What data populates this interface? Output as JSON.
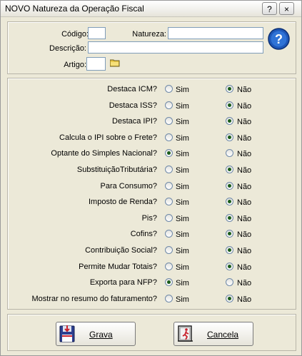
{
  "window": {
    "title": "NOVO Natureza da Operação Fiscal",
    "help_label": "?",
    "close_label": "×"
  },
  "form": {
    "codigo_label": "Código:",
    "natureza_label": "Natureza:",
    "descricao_label": "Descrição:",
    "artigo_label": "Artigo:",
    "codigo_value": "",
    "natureza_value": "",
    "descricao_value": "",
    "artigo_value": ""
  },
  "options": {
    "sim_label": "Sim",
    "nao_label": "Não",
    "questions": [
      {
        "label": "Destaca ICM?",
        "selected": "nao"
      },
      {
        "label": "Destaca ISS?",
        "selected": "nao"
      },
      {
        "label": "Destaca IPI?",
        "selected": "nao"
      },
      {
        "label": "Calcula o IPI sobre o Frete?",
        "selected": "nao"
      },
      {
        "label": "Optante do Simples Nacional?",
        "selected": "sim"
      },
      {
        "label": "SubstituiçãoTributária?",
        "selected": "nao"
      },
      {
        "label": "Para Consumo?",
        "selected": "nao"
      },
      {
        "label": "Imposto de Renda?",
        "selected": "nao"
      },
      {
        "label": "Pis?",
        "selected": "nao"
      },
      {
        "label": "Cofins?",
        "selected": "nao"
      },
      {
        "label": "Contribuição Social?",
        "selected": "nao"
      },
      {
        "label": "Permite Mudar Totais?",
        "selected": "nao"
      },
      {
        "label": "Exporta para NFP?",
        "selected": "sim"
      },
      {
        "label": "Mostrar no resumo do faturamento?",
        "selected": "nao"
      }
    ]
  },
  "buttons": {
    "grava_label": "Grava",
    "cancela_label": "Cancela"
  },
  "icons": {
    "help": "help-circle-icon",
    "folder": "folder-icon",
    "save": "floppy-disk-icon",
    "exit": "exit-door-icon"
  }
}
